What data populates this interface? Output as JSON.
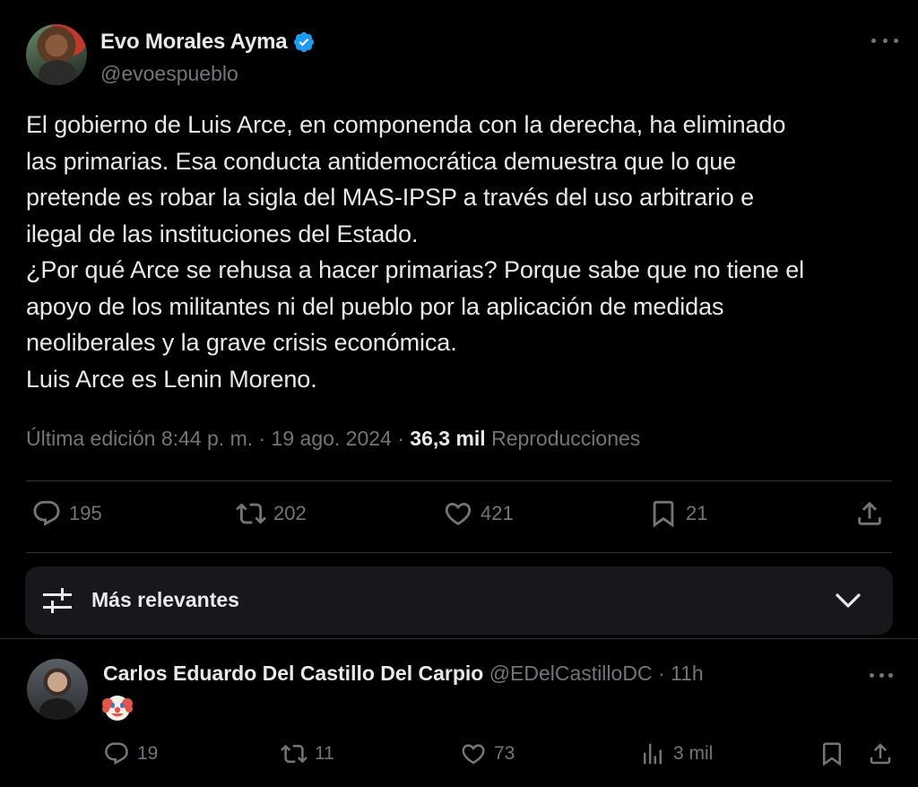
{
  "author": {
    "display_name": "Evo Morales Ayma",
    "handle": "@evoespueblo",
    "verified": true
  },
  "tweet": {
    "text": "El gobierno de Luis Arce, en componenda con la derecha, ha eliminado\nlas primarias. Esa conducta antidemocrática demuestra que lo que\npretende es robar la sigla del MAS-IPSP a través del uso arbitrario e\nilegal de las instituciones del Estado.\n¿Por qué Arce se rehusa a hacer primarias? Porque sabe que no tiene el\napoyo de los militantes ni del pueblo por la aplicación de medidas\nneoliberales y la grave crisis económica.\nLuis Arce es Lenin Moreno.",
    "meta_prefix": "Última edición 8:44 p. m. · 19 ago. 2024 · ",
    "views_count": "36,3 mil",
    "views_label": " Reproducciones"
  },
  "actions": {
    "replies": "195",
    "reposts": "202",
    "likes": "421",
    "bookmarks": "21"
  },
  "sort": {
    "label": "Más relevantes"
  },
  "reply": {
    "display_name": "Carlos Eduardo Del Castillo Del Carpio",
    "handle": "@EDelCastilloDC",
    "separator": "·",
    "time": "11h",
    "content_emoji": "clown-face",
    "actions": {
      "replies": "19",
      "reposts": "11",
      "likes": "73",
      "views": "3 mil"
    }
  },
  "colors": {
    "background": "#000000",
    "text": "#e7e9ea",
    "secondary": "#71767b",
    "verified": "#1d9bf0",
    "divider": "#2f3336",
    "sort_bg": "#16181c"
  },
  "icons": {
    "verified": "verified-badge-icon",
    "more": "more-icon",
    "reply": "reply-icon",
    "repost": "repost-icon",
    "like": "like-icon",
    "bookmark": "bookmark-icon",
    "share": "share-icon",
    "filter": "filter-sliders-icon",
    "chevron": "chevron-down-icon",
    "views": "views-icon"
  }
}
